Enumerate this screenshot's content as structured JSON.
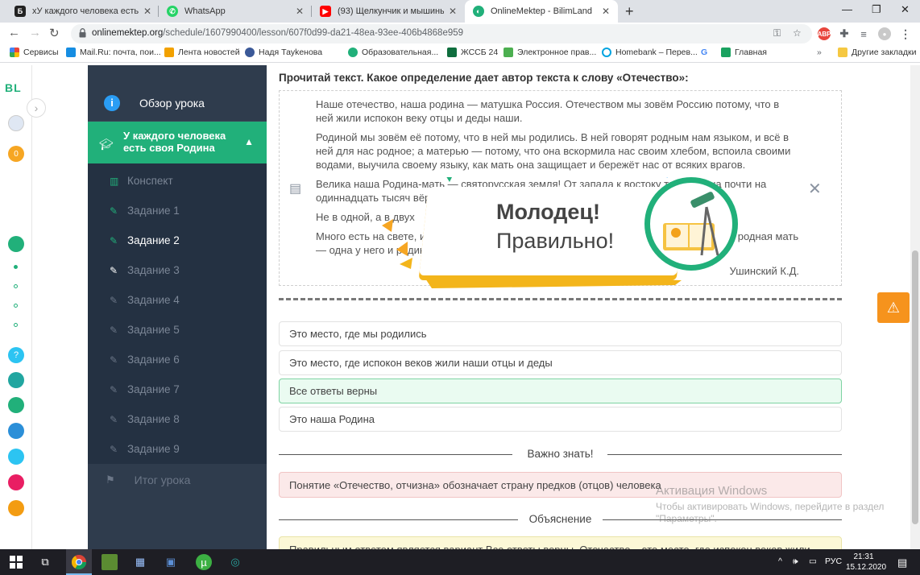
{
  "browser": {
    "tabs": [
      {
        "title": "хУ каждого человека есть своя",
        "favicon_color": "#222222",
        "active": false
      },
      {
        "title": "WhatsApp",
        "favicon_color": "#25d366",
        "active": false
      },
      {
        "title": "(93) Щелкунчик и мышиный ко",
        "favicon_color": "#ff0000",
        "active": false
      },
      {
        "title": "OnlineMektep - BilimLand",
        "favicon_color": "#21b07a",
        "active": true
      }
    ],
    "new_tab_label": "+",
    "url_host": "onlinemektep.org",
    "url_path": "/schedule/1607990400/lesson/607f0d99-da21-48ea-93ee-406b4868e959"
  },
  "bookmarks": [
    {
      "label": "Сервисы",
      "color": "#e8453c"
    },
    {
      "label": "Mail.Ru: почта, пои...",
      "color": "#168de2"
    },
    {
      "label": "Лента новостей",
      "color": "#f2a100"
    },
    {
      "label": "Надя Тауkенова",
      "color": "#3b5998"
    },
    {
      "label": "Образовательная...",
      "color": "#21b07a"
    },
    {
      "label": "ЖССБ 24",
      "color": "#0f6e3e"
    },
    {
      "label": "Электронное прав...",
      "color": "#4caf50"
    },
    {
      "label": "Homebank – Перев...",
      "color": "#00a3e0"
    },
    {
      "label": "G",
      "color": "#4285f4"
    },
    {
      "label": "Главная",
      "color": "#1aa260"
    }
  ],
  "bookmarks_other": "Другие закладки",
  "rail": {
    "logo": "BL",
    "badge": "0"
  },
  "sidebar": {
    "overview": "Обзор урока",
    "section": "У каждого человека есть своя Родина",
    "items": [
      {
        "label": "Конспект",
        "state": "done"
      },
      {
        "label": "Задание 1",
        "state": "done"
      },
      {
        "label": "Задание 2",
        "state": "current"
      },
      {
        "label": "Задание 3",
        "state": "todo"
      },
      {
        "label": "Задание 4",
        "state": "todo"
      },
      {
        "label": "Задание 5",
        "state": "todo"
      },
      {
        "label": "Задание 6",
        "state": "todo"
      },
      {
        "label": "Задание 7",
        "state": "todo"
      },
      {
        "label": "Задание 8",
        "state": "todo"
      },
      {
        "label": "Задание 9",
        "state": "todo"
      }
    ],
    "summary": "Итог урока"
  },
  "main": {
    "question": "Прочитай текст. Какое определение дает автор текста к слову «Отечество»:",
    "text_paragraphs": [
      "Наше отечество, наша родина — матушка Россия. Отечеством мы зовём Россию потому, что в ней жили испокон веку отцы и деды наши.",
      "Родиной мы зовём её потому, что в ней мы родились. В ней говорят родным нам языком, и всё в ней для нас родное; а матерью — потому, что она вскормила нас своим хлебом, вспоила своими водами, выучила своему языку, как мать она защищает и бережёт нас от всяких врагов.",
      "Велика наша Родина-мать — святорусская земля! От запада к востоку тянется она почти на одиннадцать тысяч вёрст.",
      "Не в одной, а в двух",
      "Много есть на свете, и кроме России, всяких государств и земель, но одна у человека родная мать — одна у него и родина."
    ],
    "author": "Ушинский К.Д.",
    "answers": [
      {
        "label": "Это место, где мы родились",
        "correct": false
      },
      {
        "label": "Это место, где испокон веков жили наши отцы и деды",
        "correct": false
      },
      {
        "label": "Все ответы верны",
        "correct": true
      },
      {
        "label": "Это наша Родина",
        "correct": false
      }
    ],
    "important_title": "Важно знать!",
    "important_text": "Понятие «Отечество, отчизна» обозначает страну предков (отцов) человека",
    "explanation_title": "Объяснение",
    "explanation_text": "Правильным ответом является вариант Все ответы верны. Отечество – это место, где испокон веков жили"
  },
  "popup": {
    "title": "Молодец!",
    "subtitle": "Правильно!",
    "close": "✕"
  },
  "watermark": {
    "title": "Активация Windows",
    "text": "Чтобы активировать Windows, перейдите в раздел \"Параметры\"."
  },
  "taskbar": {
    "lang": "РУС",
    "time": "21:31",
    "date": "15.12.2020"
  }
}
